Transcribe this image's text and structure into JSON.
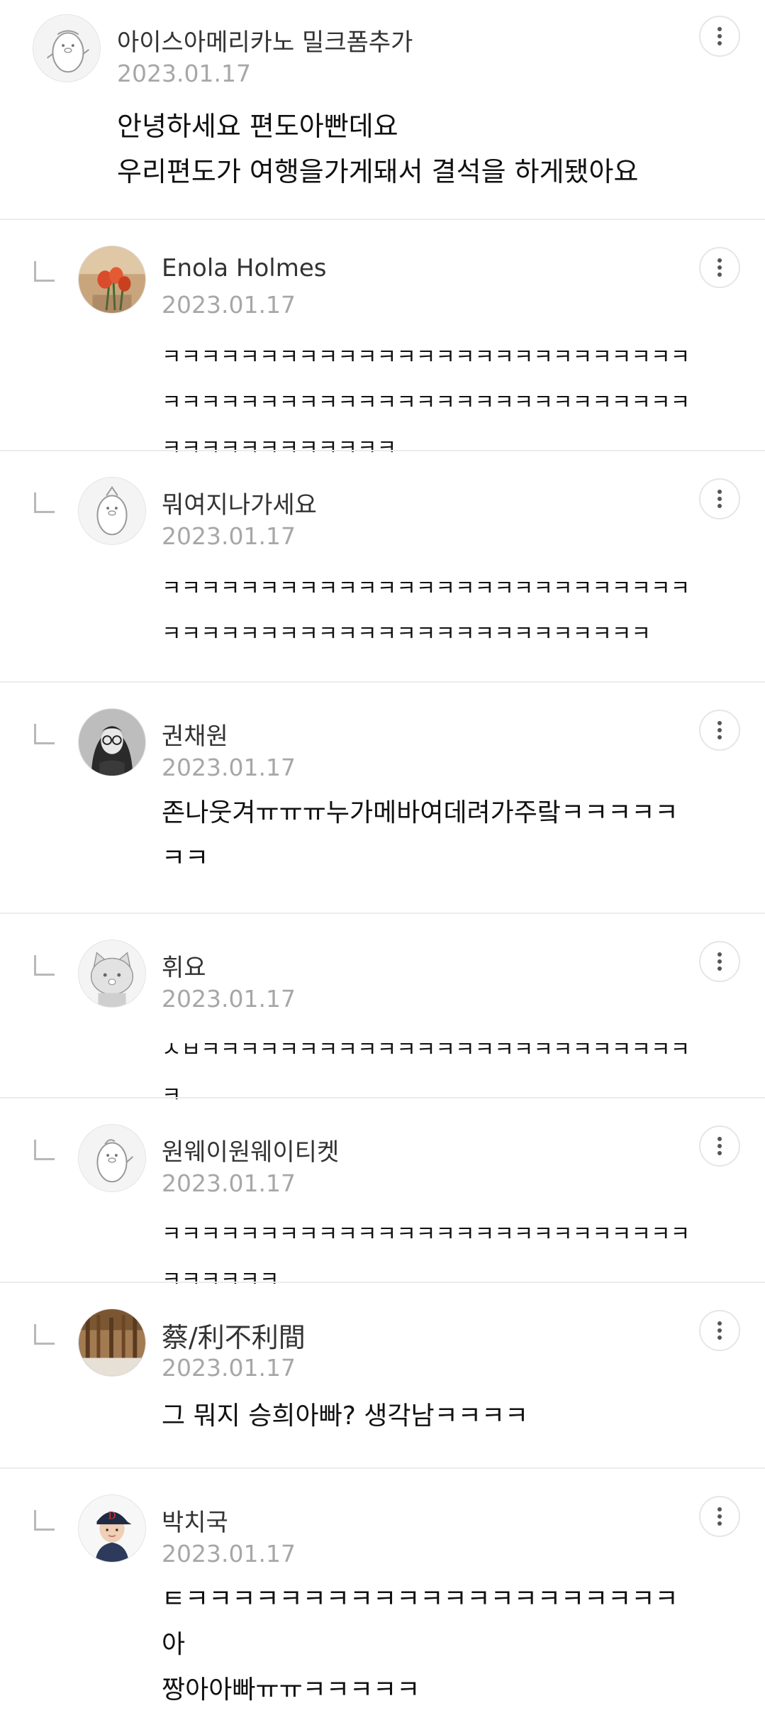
{
  "comments": [
    {
      "name": "아이스아메리카노 밀크폼추가",
      "date": "2023.01.17",
      "text": "안녕하세요 편도아빤데요\n우리편도가 여행을가게돼서 결석을 하게됐아요",
      "avatar": "penguin-default-avatar",
      "reply": false
    },
    {
      "name": "Enola Holmes",
      "date": "2023.01.17",
      "text": "ㅋㅋㅋㅋㅋㅋㅋㅋㅋㅋㅋㅋㅋㅋㅋㅋㅋㅋㅋㅋㅋㅋㅋㅋㅋㅋㅋㅋㅋㅋㅋㅋㅋㅋㅋㅋㅋㅋㅋㅋㅋㅋㅋㅋㅋㅋㅋㅋㅋㅋㅋㅋㅋㅋㅋㅋㅋㅋㅋㅋㅋㅋㅋㅋㅋㅋ",
      "avatar": "tulip-photo-avatar",
      "reply": true
    },
    {
      "name": "뭐여지나가세요",
      "date": "2023.01.17",
      "text": "ㅋㅋㅋㅋㅋㅋㅋㅋㅋㅋㅋㅋㅋㅋㅋㅋㅋㅋㅋㅋㅋㅋㅋㅋㅋㅋㅋㅋㅋㅋㅋㅋㅋㅋㅋㅋㅋㅋㅋㅋㅋㅋㅋㅋㅋㅋㅋㅋㅋㅋㅋㅋ",
      "avatar": "penguin-default-avatar",
      "reply": true
    },
    {
      "name": "권채원",
      "date": "2023.01.17",
      "text": "존나웃겨ㅠㅠㅠ누가메바여데려가주랔ㅋㅋㅋㅋㅋㅋㅋ",
      "avatar": "portrait-photo-avatar",
      "reply": true
    },
    {
      "name": "휘요",
      "date": "2023.01.17",
      "text": "ㅅㅂㅋㅋㅋㅋㅋㅋㅋㅋㅋㅋㅋㅋㅋㅋㅋㅋㅋㅋㅋㅋㅋㅋㅋㅋㅋㅋ",
      "avatar": "cat-default-avatar",
      "reply": true
    },
    {
      "name": "원웨이원웨이티켓",
      "date": "2023.01.17",
      "text": "ㅋㅋㅋㅋㅋㅋㅋㅋㅋㅋㅋㅋㅋㅋㅋㅋㅋㅋㅋㅋㅋㅋㅋㅋㅋㅋㅋㅋㅋㅋㅋㅋㅋ",
      "avatar": "penguin-default-avatar",
      "reply": true
    },
    {
      "name": "蔡/利不利間",
      "date": "2023.01.17",
      "text": "그 뭐지 승희아빠? 생각남ㅋㅋㅋㅋ",
      "avatar": "door-photo-avatar",
      "reply": true
    },
    {
      "name": "박치국",
      "date": "2023.01.17",
      "text": "ㅌㅋㅋㅋㅋㅋㅋㅋㅋㅋㅋㅋㅋㅋㅋㅋㅋㅋㅋㅋㅋㅋ아\n짱아아빠ㅠㅠㅋㅋㅋㅋㅋ",
      "avatar": "baseball-player-avatar",
      "reply": true
    }
  ],
  "more_icon": "more-vertical-icon",
  "reply_icon": "reply-indent-icon"
}
